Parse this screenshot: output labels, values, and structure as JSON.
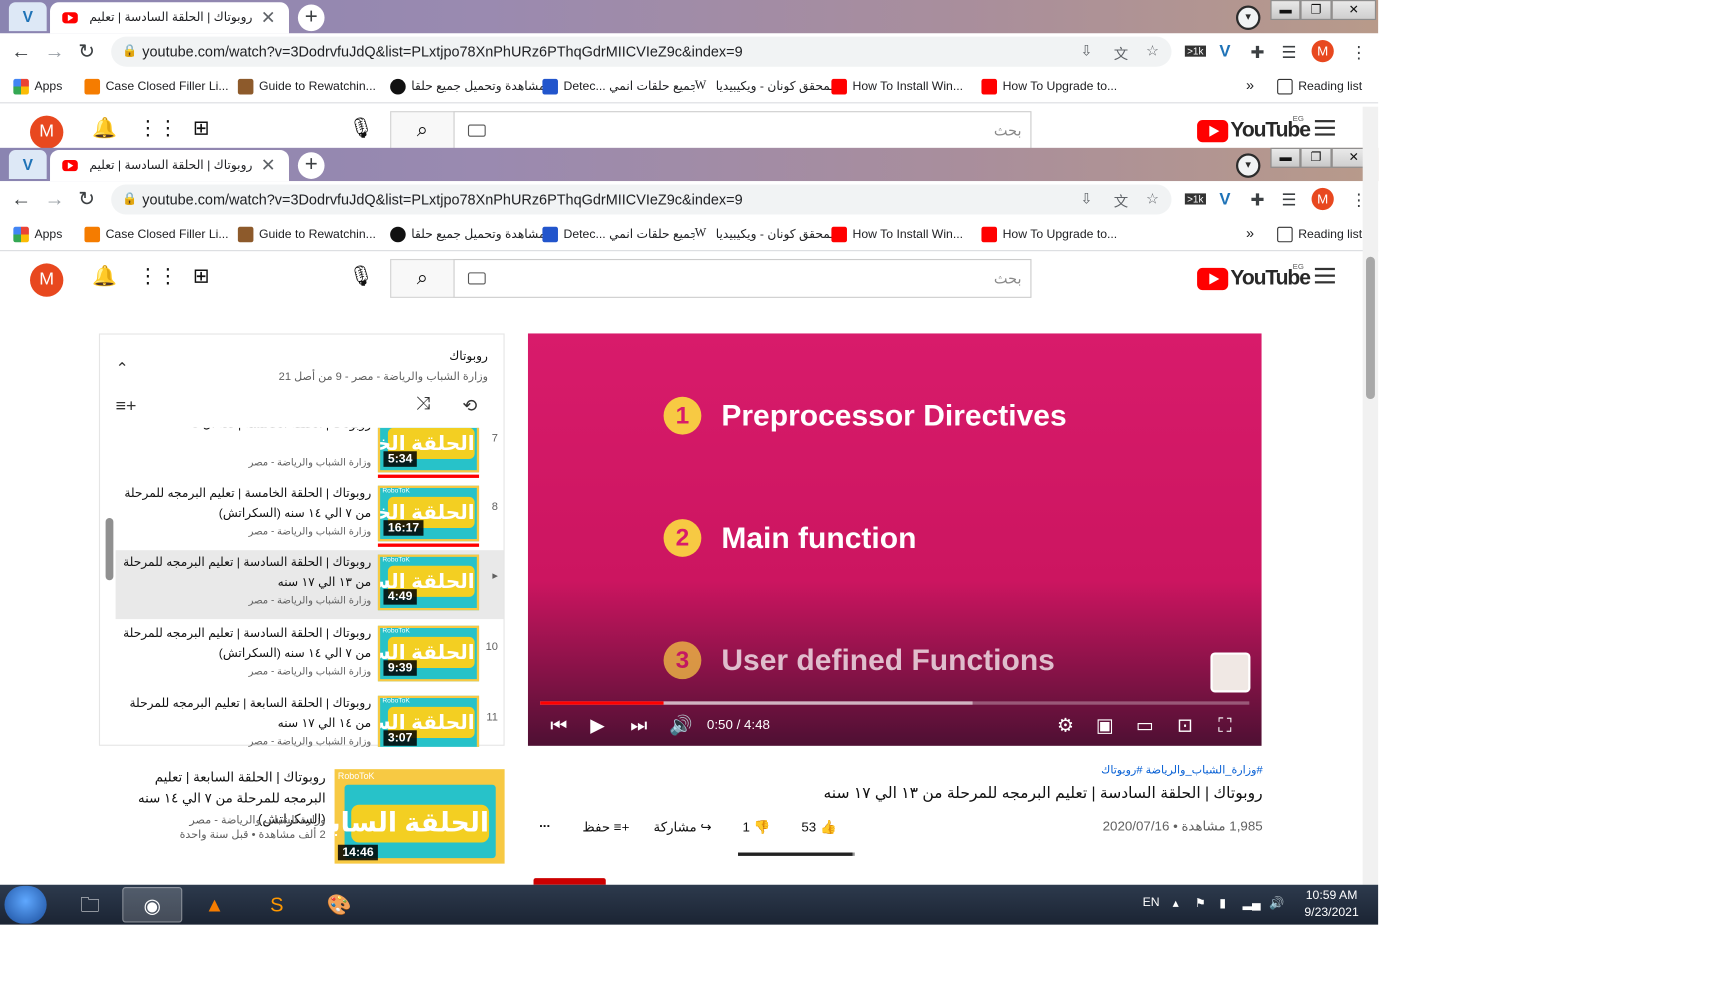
{
  "browser": {
    "vpn_tab_label": "V",
    "tab_title": "روبوتاك | الحلقة السادسة | تعليم البر...",
    "tab_close": "✕",
    "new_tab": "+",
    "url": "youtube.com/watch?v=3DodrvfuJdQ&list=PLxtjpo78XnPhURz6PThqGdrMIICVIeZ9c&index=9",
    "profile_initial": "M",
    "extension_badge": ">1k",
    "window_controls": {
      "minimize": "▬",
      "maximize": "❐",
      "close": "✕"
    },
    "bookmarks": [
      {
        "label": "Apps",
        "color": "#5f6368"
      },
      {
        "label": "Case Closed Filler Li...",
        "color": "#f57c00"
      },
      {
        "label": "Guide to Rewatchin...",
        "color": "#8d5a2b"
      },
      {
        "label": "مشاهدة وتحميل جميع حلقا...",
        "color": "#111111"
      },
      {
        "label": "Detec... جميع حلقات انمي",
        "color": "#2255cc"
      },
      {
        "label": "المحقق كونان - ويكيبيديا",
        "color": "#111111"
      },
      {
        "label": "How To Install Win...",
        "color": "#ff0000"
      },
      {
        "label": "How To Upgrade to...",
        "color": "#ff0000"
      }
    ],
    "more_bookmarks": "»",
    "reading_list": "Reading list"
  },
  "youtube": {
    "avatar_initial": "M",
    "search_placeholder": "بحث",
    "logo_text": "YouTube",
    "country_code": "EG",
    "icons": {
      "notifications": "bell-icon",
      "apps": "apps-grid-icon",
      "create": "create-video-icon",
      "mic": "mic-icon",
      "search": "search-icon",
      "menu": "hamburger-icon"
    }
  },
  "playlist": {
    "title": "روبوتاك",
    "subtitle": "وزارة الشباب والرياضة - مصر - 9 من أصل 21",
    "items": [
      {
        "num": "7",
        "title": "روبوتاك | الحلقة الخامسة | لغة ال C",
        "channel": "وزارة الشباب والرياضة - مصر",
        "duration": "5:34",
        "thumb_text": "الحلقة الخامسة",
        "watched": 1.0,
        "active": false
      },
      {
        "num": "8",
        "title": "روبوتاك | الحلقة الخامسة | تعليم البرمجه للمرحلة من ٧ الي ١٤ سنه (السكراتش)",
        "channel": "وزارة الشباب والرياضة - مصر",
        "duration": "16:17",
        "thumb_text": "الحلقة الخامسة",
        "watched": 1.0,
        "active": false
      },
      {
        "num": "▸",
        "title": "روبوتاك | الحلقة السادسة | تعليم البرمجه للمرحلة من ١٣ الي ١٧ سنه",
        "channel": "وزارة الشباب والرياضة - مصر",
        "duration": "4:49",
        "thumb_text": "الحلقة السادسة",
        "watched": 0.0,
        "active": true
      },
      {
        "num": "10",
        "title": "روبوتاك | الحلقة السادسة | تعليم البرمجه للمرحلة من ٧ الي ١٤ سنه (السكراتش)",
        "channel": "وزارة الشباب والرياضة - مصر",
        "duration": "9:39",
        "thumb_text": "الحلقة السادسة",
        "watched": 0.0,
        "active": false
      },
      {
        "num": "11",
        "title": "روبوتاك | الحلقة السابعة | تعليم البرمجه للمرحلة من ١٤ الي ١٧ سنه",
        "channel": "وزارة الشباب والرياضة - مصر",
        "duration": "3:07",
        "thumb_text": "الحلقة السابعة",
        "watched": 0.0,
        "active": false
      }
    ]
  },
  "player": {
    "slides": [
      {
        "num": "1",
        "text": "Preprocessor Directives"
      },
      {
        "num": "2",
        "text": "Main function"
      },
      {
        "num": "3",
        "text": "User defined Functions"
      }
    ],
    "time": "0:50 / 4:48",
    "progress": 0.174,
    "buffered": 0.61,
    "controls": [
      "previous-icon",
      "play-icon",
      "next-icon",
      "volume-icon",
      "settings-icon",
      "miniplayer-icon",
      "theater-icon",
      "cast-icon",
      "fullscreen-icon"
    ]
  },
  "video_info": {
    "hashtags": "#وزارة_الشباب_والرياضة #روبوتاك",
    "title": "روبوتاك | الحلقة السادسة | تعليم البرمجه للمرحلة من ١٣ الي ١٧ سنه",
    "views": "1,985 مشاهدة • 2020/07/16",
    "likes": "53",
    "dislikes": "1",
    "share": "مشاركة",
    "save": "حفظ",
    "more": "...",
    "like_ratio": 0.98
  },
  "recommendation": {
    "title": "روبوتاك | الحلقة السابعة | تعليم البرمجه للمرحلة من ٧ الي ١٤ سنه (السكراتش)",
    "channel": "وزارة الشباب والرياضة - مصر",
    "meta": "2 ألف مشاهدة • قبل سنة واحدة",
    "duration": "14:46",
    "brand": "RoboToK",
    "thumb_text": "الحلقة السابعة"
  },
  "taskbar": {
    "apps": [
      "windows-start-icon",
      "file-explorer-icon",
      "chrome-icon",
      "vlc-icon",
      "sublime-icon",
      "paint-icon"
    ],
    "language": "EN",
    "time": "10:59 AM",
    "date": "9/23/2021"
  }
}
